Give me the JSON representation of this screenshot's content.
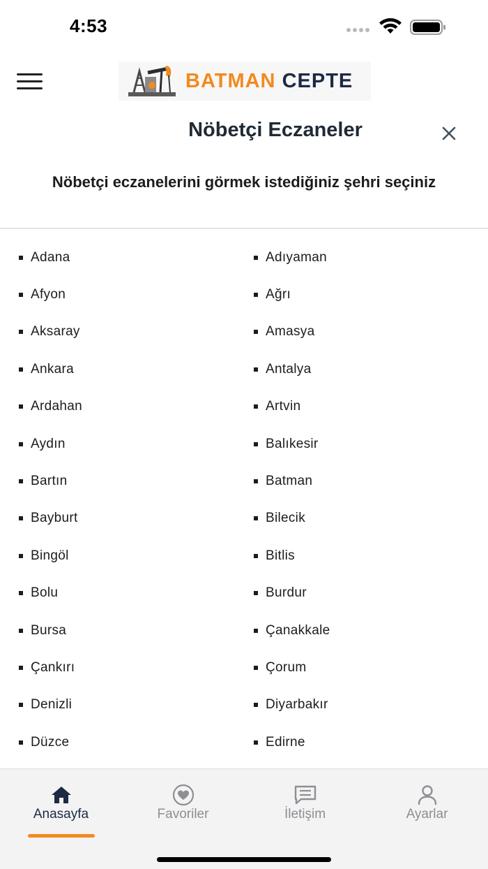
{
  "status_bar": {
    "time": "4:53"
  },
  "header": {
    "logo": {
      "part1": "BATMAN",
      "part2": "CEPTE"
    },
    "brand_colors": {
      "orange": "#f28a1f",
      "navy": "#1d2a44"
    }
  },
  "modal": {
    "title": "Nöbetçi Eczaneler",
    "instruction": "Nöbetçi eczanelerini görmek istediğiniz şehri seçiniz"
  },
  "cities": [
    "Adana",
    "Adıyaman",
    "Afyon",
    "Ağrı",
    "Aksaray",
    "Amasya",
    "Ankara",
    "Antalya",
    "Ardahan",
    "Artvin",
    "Aydın",
    "Balıkesir",
    "Bartın",
    "Batman",
    "Bayburt",
    "Bilecik",
    "Bingöl",
    "Bitlis",
    "Bolu",
    "Burdur",
    "Bursa",
    "Çanakkale",
    "Çankırı",
    "Çorum",
    "Denizli",
    "Diyarbakır",
    "Düzce",
    "Edirne"
  ],
  "tabs": [
    {
      "label": "Anasayfa",
      "icon": "home-icon",
      "active": true
    },
    {
      "label": "Favoriler",
      "icon": "heart-icon",
      "active": false
    },
    {
      "label": "İletişim",
      "icon": "message-icon",
      "active": false
    },
    {
      "label": "Ayarlar",
      "icon": "user-icon",
      "active": false
    }
  ]
}
